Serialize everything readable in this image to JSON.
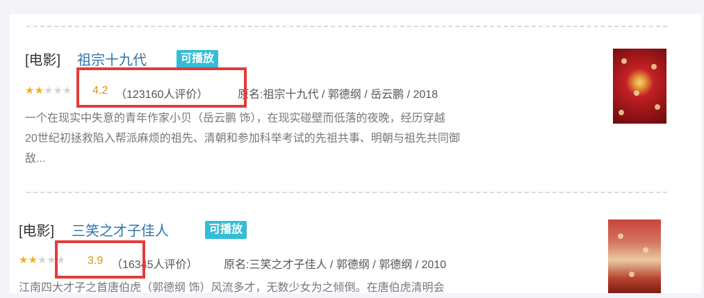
{
  "results": [
    {
      "type_tag": "[电影]",
      "title": "祖宗十九代",
      "badge": "可播放",
      "score": "4.2",
      "rating_count": "（123160人评价）",
      "meta": "原名:祖宗十九代 / 郭德纲 / 岳云鹏 / 2018",
      "stars_filled": 2,
      "stars_total": 5,
      "description_lines": [
        "一个在现实中失意的青年作家小贝（岳云鹏 饰），在现实碰壁而低落的夜晚，经历穿越",
        "20世纪初拯救陷入帮派麻烦的祖先、清朝和参加科举考试的先祖共事、明朝与祖先共同御",
        "敌..."
      ]
    },
    {
      "type_tag": "[电影]",
      "title": "三笑之才子佳人",
      "badge": "可播放",
      "score": "3.9",
      "rating_count": "（16345人评价）",
      "meta": "原名:三笑之才子佳人 / 郭德纲 / 郭德纲 / 2010",
      "stars_filled": 2,
      "stars_total": 5,
      "description_lines": [
        "江南四大才子之首唐伯虎（郭德纲 饰）风流多才，无数少女为之倾倒。在唐伯虎清明会"
      ]
    }
  ],
  "colors": {
    "title_link": "#2f74a8",
    "badge": "#35bcd8",
    "score": "#e09015",
    "highlight": "#e23b3b",
    "star_on": "#f5b01a",
    "star_off": "#d3d3d3"
  }
}
